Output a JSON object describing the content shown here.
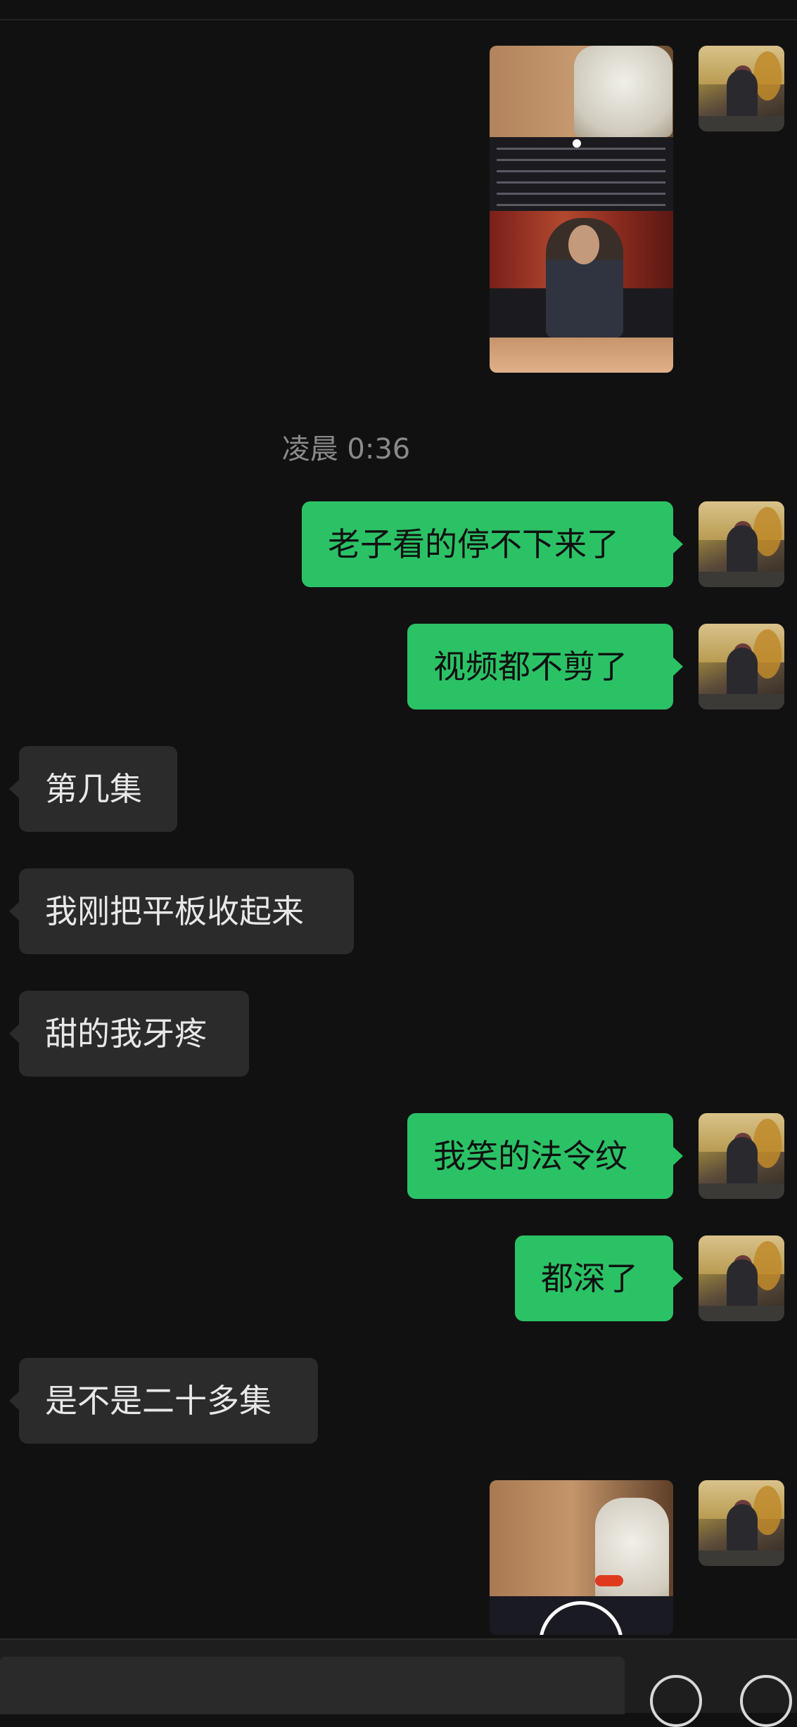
{
  "timestamp": "凌晨 0:36",
  "messages": [
    {
      "side": "out",
      "text": "老子看的停不下来了"
    },
    {
      "side": "out",
      "text": "视频都不剪了"
    },
    {
      "side": "in",
      "text": "第几集"
    },
    {
      "side": "in",
      "text": "我刚把平板收起来"
    },
    {
      "side": "in",
      "text": "甜的我牙疼"
    },
    {
      "side": "out",
      "text": "我笑的法令纹"
    },
    {
      "side": "out",
      "text": "都深了"
    },
    {
      "side": "in",
      "text": "是不是二十多集"
    }
  ],
  "colors": {
    "background": "#111111",
    "outgoing_bubble": "#2bc266",
    "incoming_bubble": "#2b2b2b"
  },
  "icons": [
    "emoji-icon",
    "add-icon",
    "play-icon"
  ]
}
